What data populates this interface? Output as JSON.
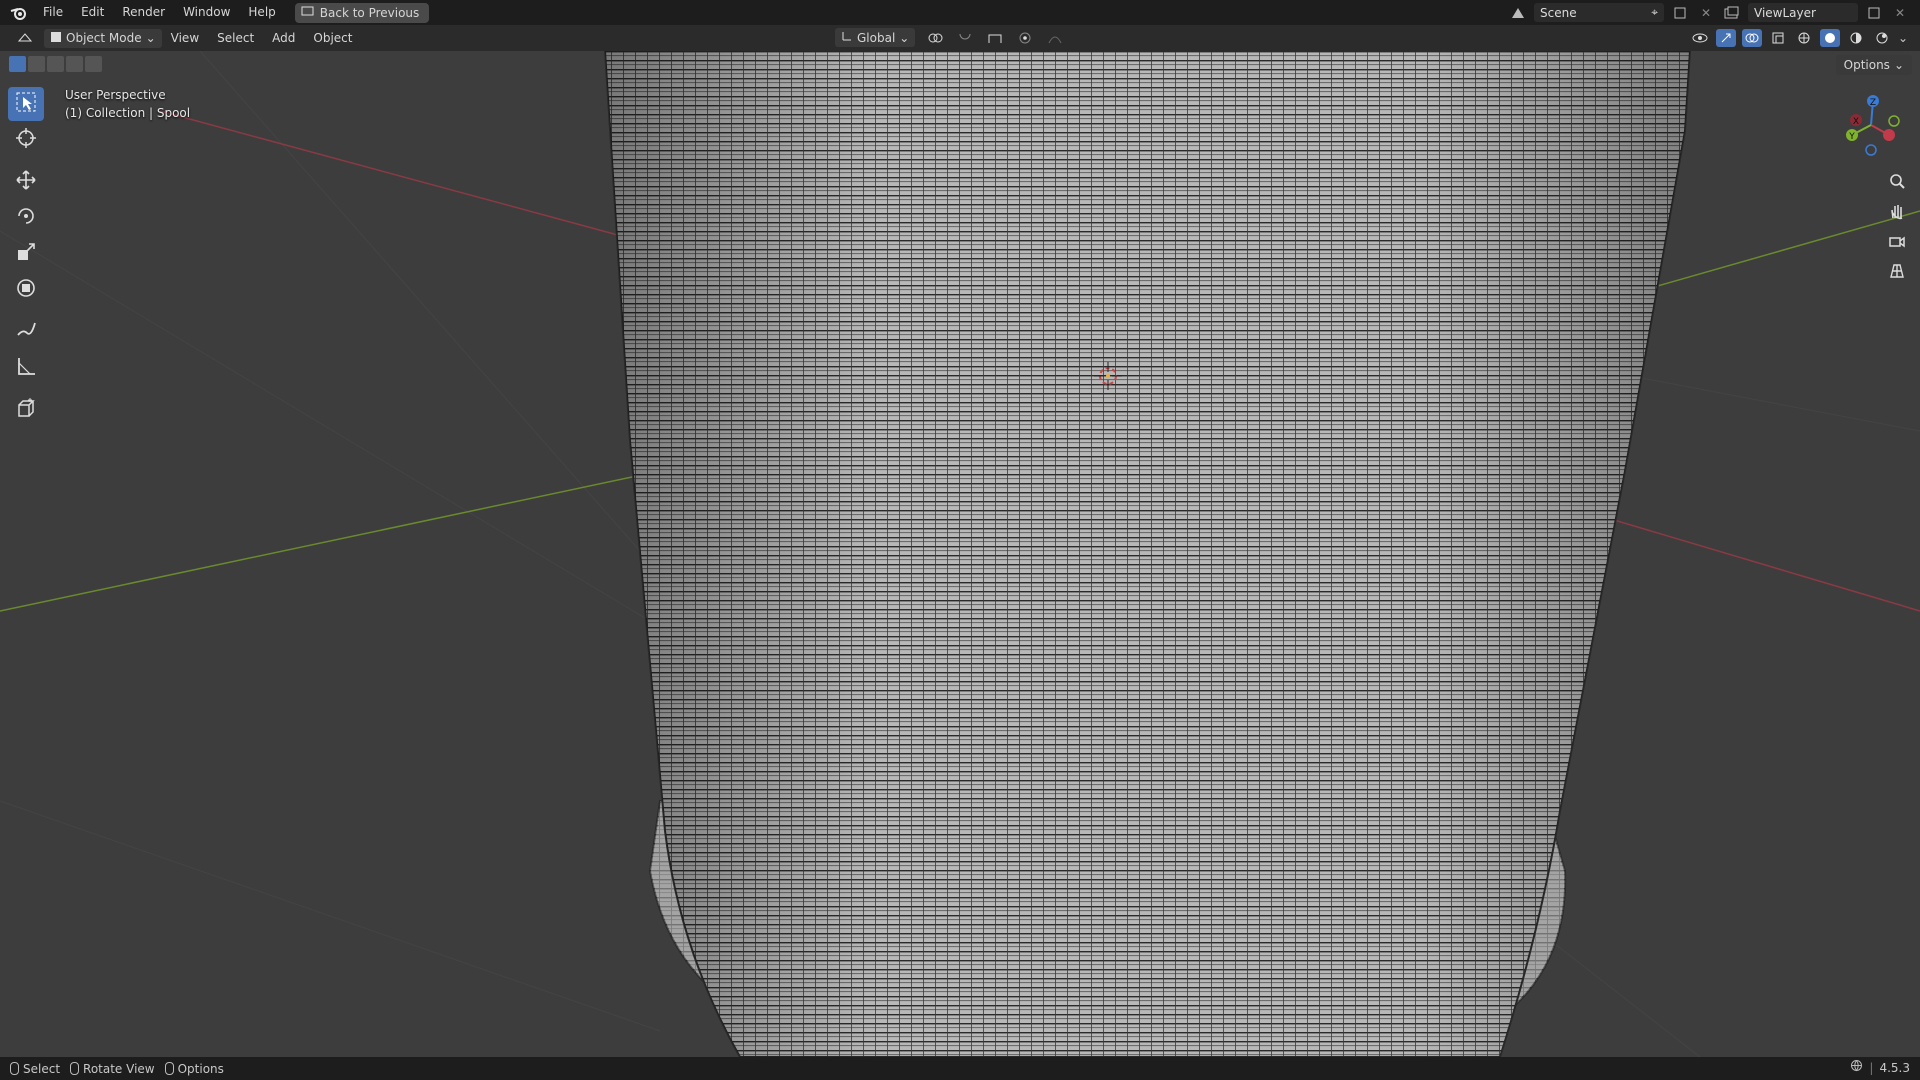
{
  "app": {
    "name": "Blender",
    "version": "4.5.3"
  },
  "menu": [
    "File",
    "Edit",
    "Render",
    "Window",
    "Help"
  ],
  "back_button": "Back to Previous",
  "scene": {
    "label": "Scene",
    "view_layer": "ViewLayer"
  },
  "header": {
    "mode": "Object Mode",
    "menus": [
      "View",
      "Select",
      "Add",
      "Object"
    ],
    "transform_orientation": "Global",
    "options_label": "Options"
  },
  "viewport": {
    "view_name": "User Perspective",
    "collection_info": "(1) Collection | Spool",
    "gizmo_axes": {
      "x": "X",
      "y": "Y",
      "z": "Z"
    }
  },
  "toolbar": [
    "select-box",
    "cursor",
    "move",
    "rotate",
    "scale",
    "transform",
    "annotate",
    "measure",
    "add-cube"
  ],
  "status": {
    "hints": [
      "Select",
      "Rotate View",
      "Options"
    ]
  },
  "colors": {
    "accent": "#4772b3",
    "x_axis": "#c23b4a",
    "y_axis": "#7fb32e",
    "z_axis": "#3a7bd5"
  }
}
